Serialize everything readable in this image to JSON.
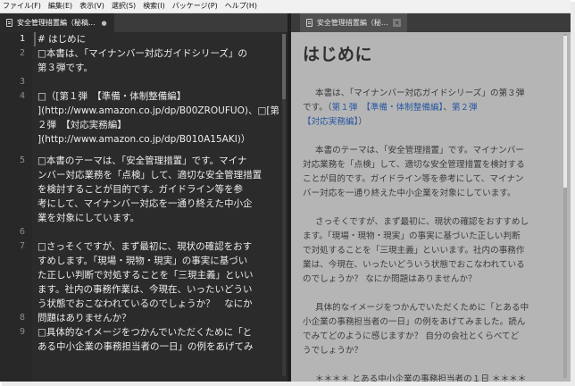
{
  "menubar": {
    "items": [
      "ファイル(F)",
      "編集(E)",
      "表示(V)",
      "選択(S)",
      "検索(I)",
      "パッケージ(P)",
      "ヘルプ(H)"
    ]
  },
  "left_tab": {
    "title": "安全管理措置編（秘稿...",
    "close_glyph": "●"
  },
  "right_tab": {
    "title": "安全管理措置編（秘稿...",
    "close_glyph": "✕"
  },
  "editor": {
    "line_numbers": [
      "1",
      "2",
      "3",
      "4",
      "5",
      "6",
      "7",
      "8",
      "9"
    ],
    "lines": [
      "# はじめに",
      "□本書は、「マイナンバー対応ガイドシリーズ」の",
      "第３弾です。",
      "□（[第１弾　【準備・体制整備編】",
      "](http://www.amazon.co.jp/dp/B00ZROUFUO)、□[第",
      "２弾　【対応実務編】",
      "](http://www.amazon.co.jp/dp/B010A15AKI)）",
      "",
      "□本書のテーマは、「安全管理措置」です。マイナ",
      "ンバー対応業務を「点検」して、適切な安全管理措置",
      "を検討することが目的です。ガイドライン等を参",
      "考にして、マイナンバー対応を一通り終えた中小企",
      "業を対象にしています。",
      "",
      "□さっそくですが、まず最初に、現状の確認をおす",
      "すめします。「現場・現物・現実」の事実に基づい",
      "た正しい判断で対処することを「三現主義」といい",
      "ます。社内の事務作業は、今現在、いったいどうい",
      "う状態でおこなわれているのでしょうか？　なにか",
      "問題はありませんか？",
      "",
      "□具体的なイメージをつかんでいただくために「と",
      "ある中小企業の事務担当者の一日」の例をあげてみ"
    ]
  },
  "preview": {
    "heading": "はじめに",
    "p1_l1": "本書は、「マイナンバー対応ガイドシリーズ」の第３弾",
    "p1_l2": "です。",
    "p1_l3_a": "（",
    "p1_link1": "第１弾　【準備・体制整備編】",
    "p1_l3_b": "、",
    "p1_link2": "第２弾",
    "p1_link3": "【対応実務編】",
    "p1_l4_b": "）",
    "p2_l1": "本書のテーマは、「安全管理措置」です。マイナンバー",
    "p2_l2": "対応業務を「点検」して、適切な安全管理措置を検討する",
    "p2_l3": "ことが目的です。ガイドライン等を参考にして、マイナン",
    "p2_l4": "バー対応を一通り終えた中小企業を対象にしています。",
    "p3_l1": "さっそくですが、まず最初に、現状の確認をおすすめし",
    "p3_l2": "ます。「現場・現物・現実」の事実に基づいた正しい判断",
    "p3_l3": "で対処することを「三現主義」といいます。社内の事務作",
    "p3_l4": "業は、今現在、いったいどういう状態でおこなわれている",
    "p3_l5": "のでしょうか？ なにか問題はありませんか？",
    "p4_l1": "具体的なイメージをつかんでいただくために「とある中",
    "p4_l2": "小企業の事務担当者の一日」の例をあげてみました。読ん",
    "p4_l3": "でみてどのように感じますか？ 自分の会社とくらべてど",
    "p4_l4": "うでしょうか？",
    "p5_l1": "＊＊＊＊ とある中小企業の事務担当者の１日 ＊＊＊＊"
  },
  "colors": {
    "editor_bg": "#2b2b2b",
    "preview_bg": "#b5b5b5",
    "link": "#2a5aa1"
  }
}
